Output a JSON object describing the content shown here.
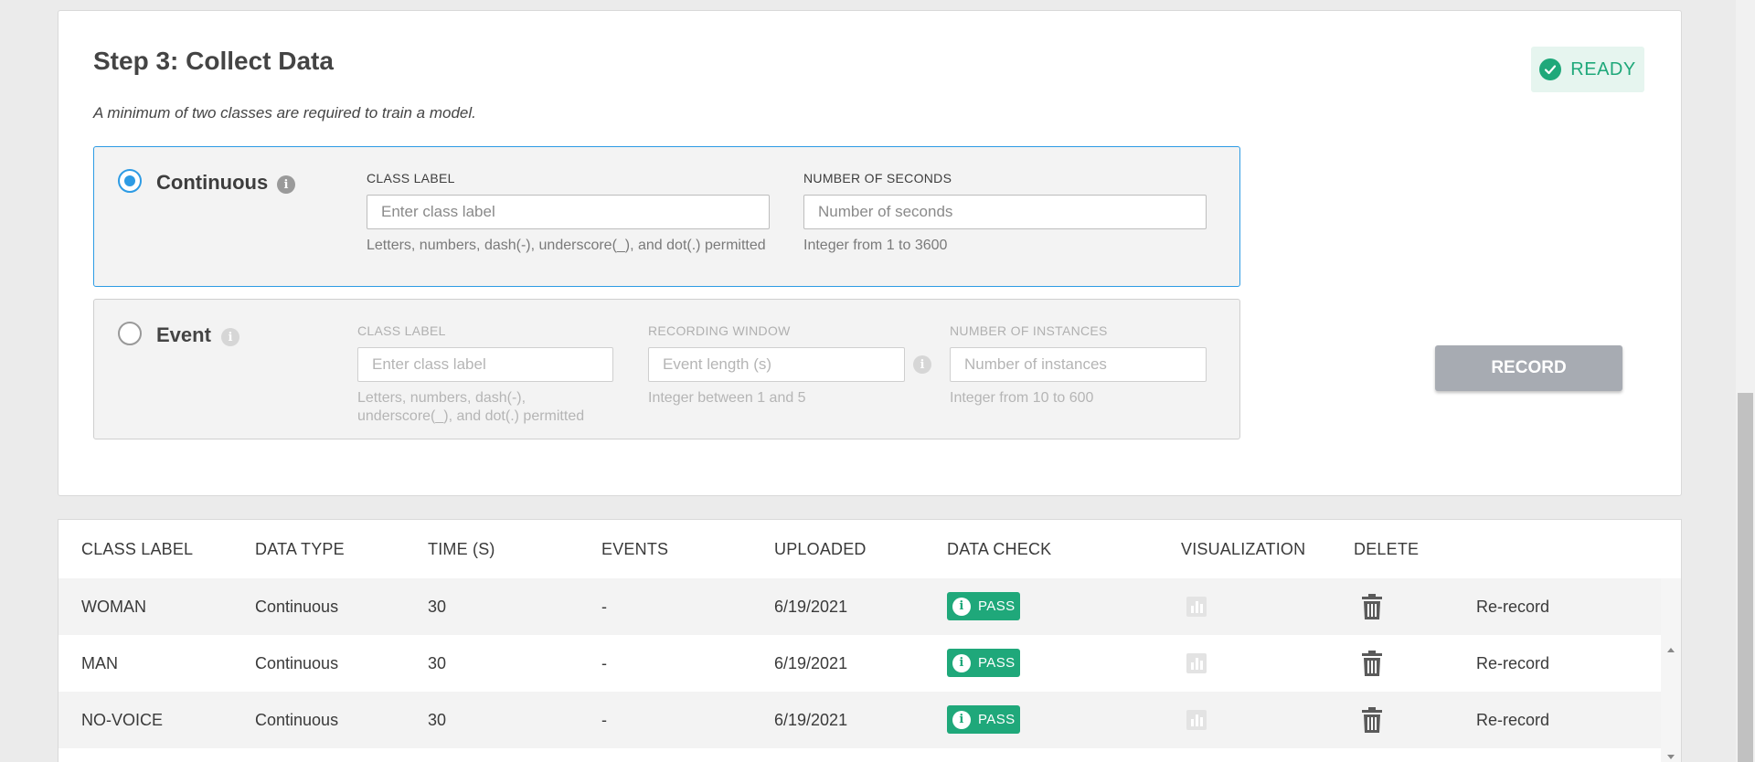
{
  "step": {
    "title": "Step 3: Collect Data",
    "note": "A minimum of two classes are required to train a model.",
    "status": "READY",
    "record_label": "RECORD"
  },
  "continuous": {
    "label": "Continuous",
    "selected": true,
    "class_label": {
      "title": "CLASS LABEL",
      "placeholder": "Enter class label",
      "help": "Letters, numbers, dash(-), underscore(_), and dot(.) permitted"
    },
    "seconds": {
      "title": "NUMBER OF SECONDS",
      "placeholder": "Number of seconds",
      "help": "Integer from 1 to 3600"
    }
  },
  "event": {
    "label": "Event",
    "selected": false,
    "class_label": {
      "title": "CLASS LABEL",
      "placeholder": "Enter class label",
      "help_line1": "Letters, numbers, dash(-),",
      "help_line2": "underscore(_), and dot(.) permitted"
    },
    "window": {
      "title": "RECORDING WINDOW",
      "placeholder": "Event length (s)",
      "help": "Integer between 1 and 5"
    },
    "instances": {
      "title": "NUMBER OF INSTANCES",
      "placeholder": "Number of instances",
      "help": "Integer from 10 to 600"
    }
  },
  "table": {
    "headers": [
      "CLASS LABEL",
      "DATA TYPE",
      "TIME (S)",
      "EVENTS",
      "UPLOADED",
      "DATA CHECK",
      "VISUALIZATION",
      "DELETE"
    ],
    "rows": [
      {
        "label": "WOMAN",
        "type": "Continuous",
        "time": "30",
        "events": "-",
        "uploaded": "6/19/2021",
        "check": "PASS",
        "action": "Re-record"
      },
      {
        "label": "MAN",
        "type": "Continuous",
        "time": "30",
        "events": "-",
        "uploaded": "6/19/2021",
        "check": "PASS",
        "action": "Re-record"
      },
      {
        "label": "NO-VOICE",
        "type": "Continuous",
        "time": "30",
        "events": "-",
        "uploaded": "6/19/2021",
        "check": "PASS",
        "action": "Re-record"
      }
    ]
  },
  "colors": {
    "accent": "#2d9be4",
    "success": "#1fa87a",
    "disabled_button": "#a7abb2"
  },
  "icons": {
    "status": "check-circle-icon",
    "info": "info-icon",
    "visualization": "bar-chart-icon",
    "delete": "trash-icon"
  }
}
